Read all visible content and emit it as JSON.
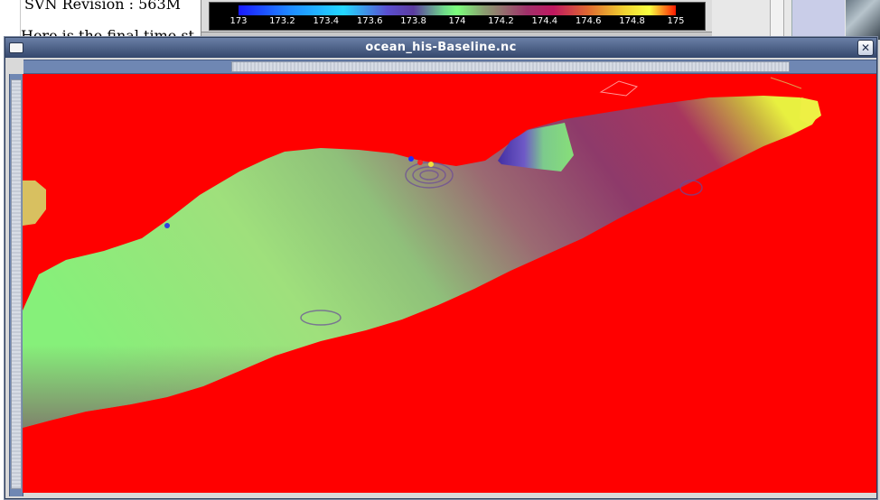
{
  "background_document": {
    "line1": "SVN Revision  : 563M",
    "line2": "Here is the final time st"
  },
  "colorbar": {
    "ticks": [
      "173",
      "173.2",
      "173.4",
      "173.6",
      "173.8",
      "174",
      "174.2",
      "174.4",
      "174.6",
      "174.8",
      "175"
    ]
  },
  "window": {
    "title": "ocean_his-Baseline.nc",
    "close_glyph": "✕"
  },
  "colors": {
    "land": "#ff0000",
    "titlebar": "#4a5d84",
    "scrollbar": "#6f87b3"
  }
}
